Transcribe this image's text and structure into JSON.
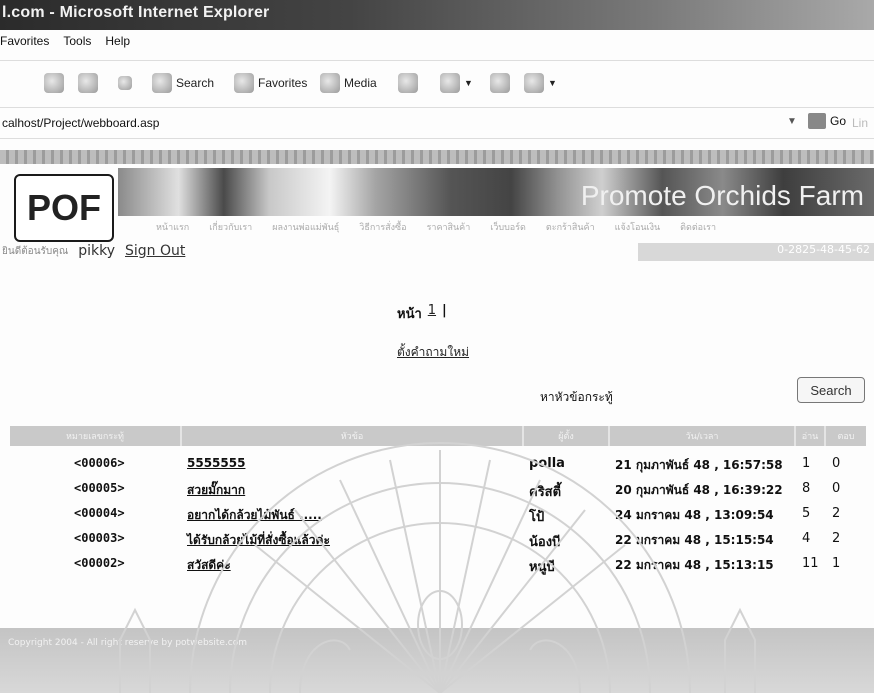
{
  "window": {
    "title": "l.com - Microsoft Internet Explorer"
  },
  "menu": {
    "items": [
      "Favorites",
      "Tools",
      "Help"
    ]
  },
  "toolbar": {
    "search_label": "Search",
    "favorites_label": "Favorites",
    "media_label": "Media"
  },
  "address": {
    "url": "calhost/Project/webboard.asp",
    "go_label": "Go",
    "links_label": "Lin"
  },
  "site": {
    "logo": "POF",
    "banner_title": "Promote Orchids Farm",
    "nav": [
      "หน้าแรก",
      "เกี่ยวกับเรา",
      "ผลงานพ่อแม่พันธุ์",
      "วิธีการสั่งซื้อ",
      "ราคาสินค้า",
      "เว็บบอร์ด",
      "ตะกร้าสินค้า",
      "แจ้งโอนเงิน",
      "ติดต่อเรา"
    ],
    "greeting": "ยินดีต้อนรับคุณ",
    "username": "pikky",
    "signout": "Sign Out",
    "phone": "0-2825-48-45-62"
  },
  "board": {
    "page_label": "หน้า",
    "page_number": "1",
    "page_sep": "|",
    "new_post": "ตั้งคำถามใหม่",
    "search_label": "หาหัวข้อกระทู้",
    "search_button": "Search",
    "headers": [
      "หมายเลขกระทู้",
      "หัวข้อ",
      "ผู้ตั้ง",
      "วัน/เวลา",
      "อ่าน",
      "ตอบ"
    ],
    "rows": [
      {
        "id": "<00006>",
        "title": "5555555",
        "author": "polla",
        "date": "21 กุมภาพันธ์ 48 , 16:57:58",
        "views": "1",
        "replies": "0"
      },
      {
        "id": "<00005>",
        "title": "สวยมั๊กมาก",
        "author": "คริสตี้",
        "date": "20 กุมภาพันธ์ 48 , 16:39:22",
        "views": "8",
        "replies": "0"
      },
      {
        "id": "<00004>",
        "title": "อยากได้กล้วยไม้พันธ์ .....",
        "author": "โป้",
        "date": "24 มกราคม 48 , 13:09:54",
        "views": "5",
        "replies": "2"
      },
      {
        "id": "<00003>",
        "title": "ได้รับกล้วยไม้ที่สั่งซื้อแล้วค่ะ",
        "author": "น้องบี",
        "date": "22 มกราคม 48 , 15:15:54",
        "views": "4",
        "replies": "2"
      },
      {
        "id": "<00002>",
        "title": "สวัสดีค่ะ",
        "author": "หนูบี",
        "date": "22 มกราคม 48 , 15:13:15",
        "views": "11",
        "replies": "1"
      }
    ]
  },
  "footer": {
    "copyright": "Copyright 2004 - All right reserve by potwebsite.com"
  }
}
